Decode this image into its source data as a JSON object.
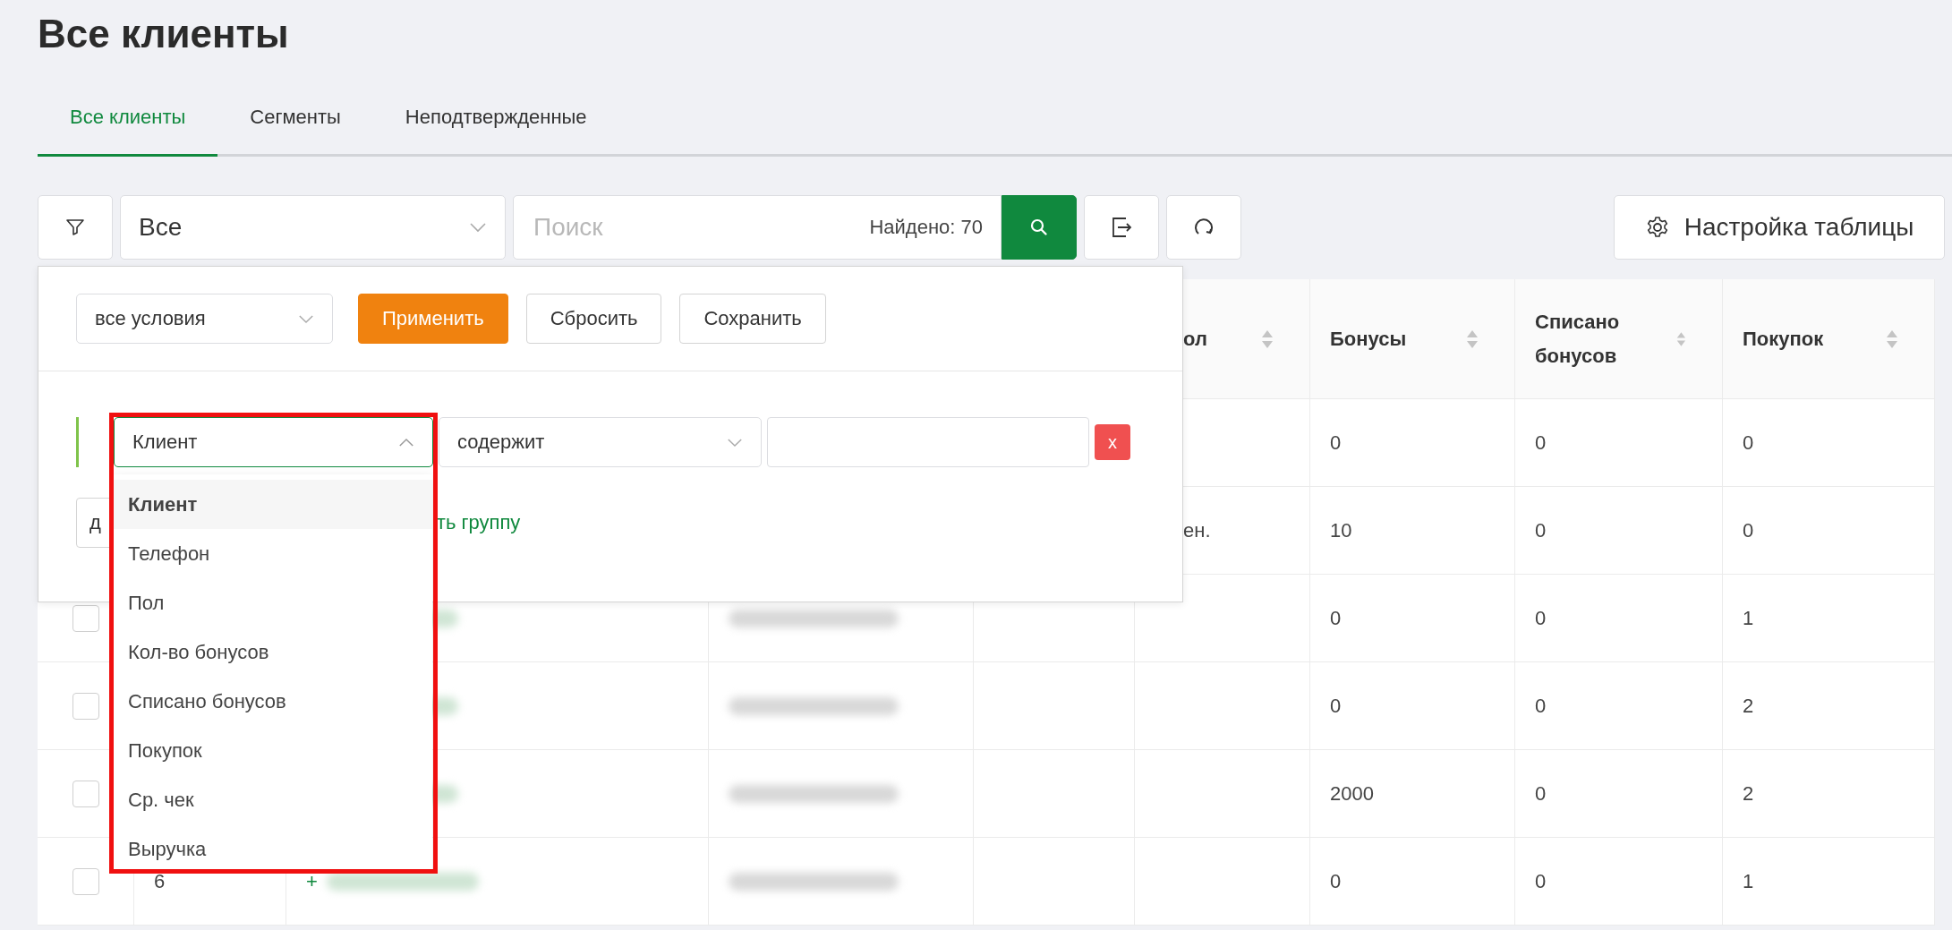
{
  "title": "Все клиенты",
  "tabs": [
    {
      "label": "Все клиенты",
      "selected": true
    },
    {
      "label": "Сегменты",
      "selected": false
    },
    {
      "label": "Неподтвержденные",
      "selected": false
    }
  ],
  "toolbar": {
    "segment_select": "Все",
    "search": {
      "placeholder": "Поиск"
    },
    "found": "Найдено: 70",
    "settings_button": "Настройка таблицы"
  },
  "table": {
    "columns": [
      {
        "label": "ол",
        "sortable": true
      },
      {
        "label": "Бонусы",
        "sortable": true
      },
      {
        "label": "Списано бонусов",
        "sortable": true
      },
      {
        "label": "Покупок",
        "sortable": true
      }
    ],
    "rows": [
      {
        "bonuses": "0",
        "written_off": "0",
        "purchases": "0"
      },
      {
        "gender": "ен.",
        "bonuses": "10",
        "written_off": "0",
        "purchases": "0"
      },
      {
        "checked": false,
        "blurred": true,
        "bonuses": "0",
        "written_off": "0",
        "purchases": "1"
      },
      {
        "checked": false,
        "blurred": true,
        "bonuses": "0",
        "written_off": "0",
        "purchases": "2"
      },
      {
        "checked": false,
        "blurred": true,
        "bonuses": "2000",
        "written_off": "0",
        "purchases": "2"
      },
      {
        "checked": false,
        "blurred": true,
        "number": "6",
        "phone_prefix": "+",
        "bonuses": "0",
        "written_off": "0",
        "purchases": "1"
      }
    ]
  },
  "filter_panel": {
    "match_select": "все условия",
    "buttons": [
      {
        "label": "Применить",
        "kind": "primary"
      },
      {
        "label": "Сбросить",
        "kind": "default"
      },
      {
        "label": "Сохранить",
        "kind": "default"
      }
    ],
    "condition": {
      "field": "Клиент",
      "expanded": true,
      "operator": "содержит",
      "remove": "x"
    },
    "add_condition_button": "д",
    "add_group_link": "ть группу",
    "field_options": [
      {
        "label": "Клиент",
        "selected": true
      },
      {
        "label": "Телефон",
        "selected": false
      },
      {
        "label": "Пол",
        "selected": false
      },
      {
        "label": "Кол-во бонусов",
        "selected": false
      },
      {
        "label": "Списано бонусов",
        "selected": false
      },
      {
        "label": "Покупок",
        "selected": false
      },
      {
        "label": "Ср. чек",
        "selected": false
      },
      {
        "label": "Выручка",
        "selected": false
      }
    ]
  }
}
